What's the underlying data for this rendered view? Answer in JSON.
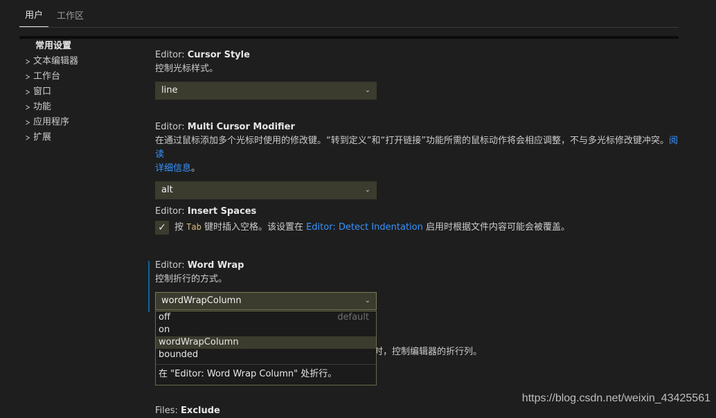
{
  "tabs": [
    {
      "label": "用户",
      "active": true
    },
    {
      "label": "工作区",
      "active": false
    }
  ],
  "sidebar": {
    "items": [
      {
        "label": "常用设置"
      },
      {
        "label": "文本编辑器"
      },
      {
        "label": "工作台"
      },
      {
        "label": "窗口"
      },
      {
        "label": "功能"
      },
      {
        "label": "应用程序"
      },
      {
        "label": "扩展"
      }
    ]
  },
  "settings": {
    "cursor_style": {
      "category": "Editor: ",
      "name": "Cursor Style",
      "description": "控制光标样式。",
      "value": "line"
    },
    "multi_cursor": {
      "category": "Editor: ",
      "name": "Multi Cursor Modifier",
      "description_line1": "在通过鼠标添加多个光标时使用的修改键。“转到定义”和“打开链接”功能所需的鼠标动作将会相应调整，不与多光标修改键冲突。",
      "link_part1": "阅读",
      "link_part2": "详细信息",
      "description_end": "。",
      "value": "alt"
    },
    "insert_spaces": {
      "category": "Editor: ",
      "name": "Insert Spaces",
      "checked": true,
      "desc_prefix": "按 ",
      "desc_code": "Tab",
      "desc_middle": " 键时插入空格。该设置在 ",
      "desc_link": "Editor: Detect Indentation",
      "desc_suffix": " 启用时根据文件内容可能会被覆盖。"
    },
    "word_wrap": {
      "category": "Editor: ",
      "name": "Word Wrap",
      "description": "控制折行的方式。",
      "value": "wordWrapColumn",
      "options": [
        {
          "label": "off",
          "hint": "default"
        },
        {
          "label": "on",
          "hint": ""
        },
        {
          "label": "wordWrapColumn",
          "hint": ""
        },
        {
          "label": "bounded",
          "hint": ""
        }
      ],
      "selected_index": 2,
      "option_description": "在 \"Editor: Word Wrap Column\" 处折行。"
    },
    "word_wrap_column_partial": "时，控制编辑器的折行列。",
    "files_exclude": {
      "category": "Files: ",
      "name": "Exclude"
    }
  },
  "icons": {
    "chevron_right": "›",
    "chevron_down": "⌄",
    "check": "✓"
  },
  "watermark": "https://blog.csdn.net/weixin_43425561"
}
